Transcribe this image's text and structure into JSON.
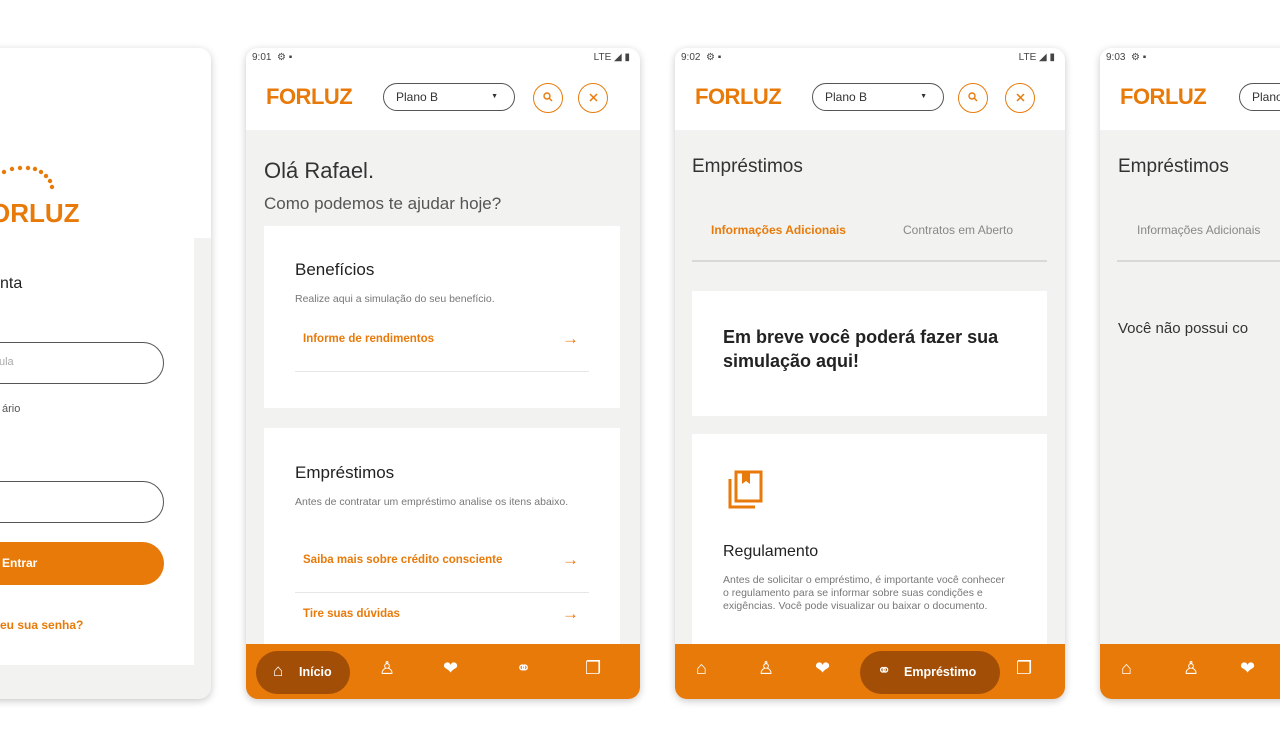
{
  "status": {
    "signal": "LTE ◢ ▮",
    "time_2": "9:01",
    "time_3": "9:02",
    "time_4": "9:03",
    "status_icons": "⚙ ▪"
  },
  "login": {
    "logo_partial": "ORLUZ",
    "title_partial": "nta",
    "field1_placeholder": "ula",
    "field1_helper": "ário",
    "login_button": "Entrar",
    "forgot_link": "eu sua senha?"
  },
  "header": {
    "logo": "FORLUZ",
    "plan_select": "Plano B",
    "plan_select_partial": "Plano"
  },
  "home": {
    "greeting": "Olá Rafael.",
    "subtitle": "Como podemos te ajudar hoje?",
    "beneficios_card": {
      "title": "Benefícios",
      "description": "Realize aqui a simulação do seu benefício.",
      "links": [
        "Informe de rendimentos"
      ]
    },
    "emprestimos_card": {
      "title": "Empréstimos",
      "description": "Antes de contratar um empréstimo analise os itens abaixo.",
      "links": [
        "Saiba mais sobre crédito consciente",
        "Tire suas dúvidas"
      ]
    },
    "nav_active_label": "Início"
  },
  "emprestimos": {
    "title": "Empréstimos",
    "tabs": [
      "Informações Adicionais",
      "Contratos em Aberto"
    ],
    "tab_partial_4": "Informações Adicionais",
    "soon_text": "Em breve você poderá fazer sua simulação aqui!",
    "regulamento": {
      "title": "Regulamento",
      "description": "Antes de solicitar o empréstimo, é importante você conhecer o regulamento para se informar sobre suas condições e exigências. Você pode visualizar ou baixar o documento."
    },
    "nav_active_label": "Empréstimo",
    "empty_partial": "Você não possui co"
  },
  "colors": {
    "accent": "#e87a0a",
    "accent_dark": "#a34e06",
    "background": "#f2f2f0"
  },
  "icons": [
    "home-icon",
    "person-icon",
    "hand-heart-icon",
    "handshake-icon",
    "cards-icon",
    "search-icon",
    "close-icon",
    "document-icon",
    "arrow-right-icon"
  ]
}
